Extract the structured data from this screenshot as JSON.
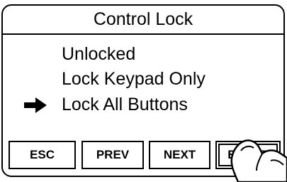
{
  "screen": {
    "title": "Control Lock"
  },
  "menu": {
    "items": [
      {
        "label": "Unlocked"
      },
      {
        "label": "Lock Keypad Only"
      },
      {
        "label": "Lock All Buttons"
      }
    ],
    "selected_index": 2,
    "pointer_icon": "arrow-right-icon"
  },
  "softkeys": {
    "esc": "ESC",
    "prev": "PREV",
    "next": "NEXT",
    "enter": "ENTER"
  },
  "hand_icon": "pointing-finger-icon",
  "colors": {
    "foreground": "#000000",
    "background": "#ffffff"
  }
}
